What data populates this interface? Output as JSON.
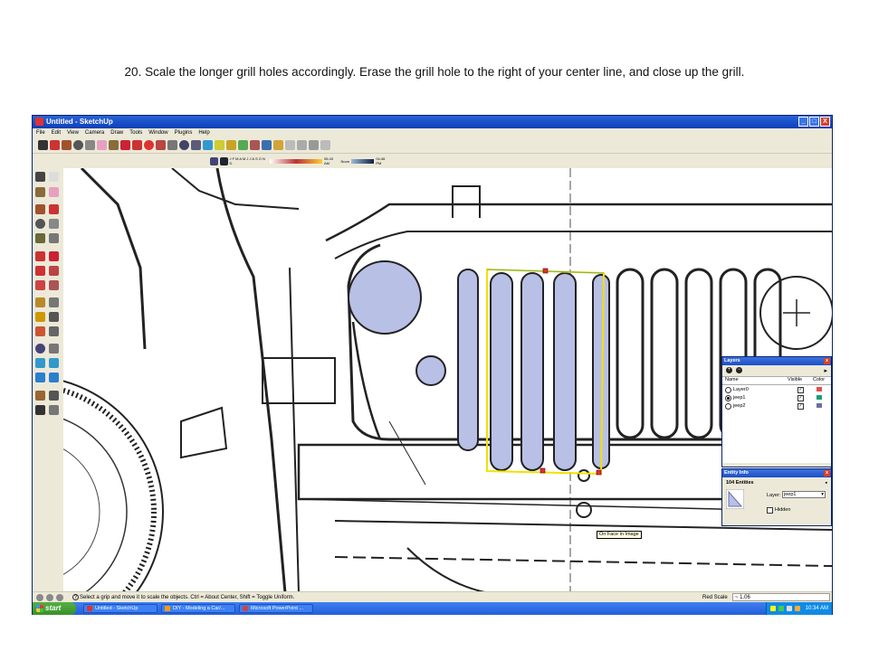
{
  "caption": "20. Scale the longer grill holes accordingly. Erase the grill hole to the right of your center line, and close up the grill.",
  "window": {
    "title": "Untitled - SketchUp",
    "controls": [
      "_",
      "□",
      "X"
    ]
  },
  "menu": [
    "File",
    "Edit",
    "View",
    "Camera",
    "Draw",
    "Tools",
    "Window",
    "Plugins",
    "Help"
  ],
  "toolbar_icons": [
    "select-icon",
    "pencil-icon",
    "rectangle-icon",
    "circle-icon",
    "arc-icon",
    "eraser-icon",
    "paint-bucket-icon",
    "push-pull-icon",
    "move-icon",
    "rotate-icon",
    "follow-me-icon",
    "tape-measure-icon",
    "orbit-icon",
    "pan-icon",
    "zoom-icon",
    "zoom-extents-icon",
    "zoom-window-icon",
    "previous-icon",
    "next-icon",
    "iso-view-icon",
    "top-view-icon",
    "front-view-icon",
    "xray-icon",
    "wireframe-icon",
    "shaded-icon"
  ],
  "shadow_bar": {
    "months": "J F M A M J J A S O N D",
    "time_start": "06:43 AM",
    "noon": "Noon",
    "time_end": "04:46 PM"
  },
  "colors": {
    "face_fill": "#b8c0e6",
    "selection": "#f2e200",
    "accent_red": "#e23030",
    "layer0": "#e05050",
    "jeep1": "#1f9a7a",
    "jeep2": "#6a70a0"
  },
  "layers_panel": {
    "title": "Layers",
    "headers": [
      "Name",
      "Visible",
      "Color"
    ],
    "rows": [
      {
        "name": "Layer0",
        "active": false,
        "visible": true,
        "color": "#e05050"
      },
      {
        "name": "jeep1",
        "active": true,
        "visible": true,
        "color": "#1f9a7a"
      },
      {
        "name": "jeep2",
        "active": false,
        "visible": true,
        "color": "#6a70a0"
      }
    ]
  },
  "entity_panel": {
    "title": "Entity Info",
    "count_label": "104 Entities",
    "layer_label": "Layer:",
    "layer_value": "jeep1",
    "hidden_label": "Hidden"
  },
  "tooltip": "On Face in Image",
  "status": {
    "hint": "Select a grip and move it to scale the objects. Ctrl = About Center, Shift = Toggle Uniform.",
    "value_label": "Red Scale",
    "value": "~ 1.06"
  },
  "taskbar": {
    "start": "start",
    "tasks": [
      "Untitled - SketchUp",
      "DIY - Modeling a Car/...",
      "Microsoft PowerPoint ..."
    ],
    "clock": "10:34 AM"
  }
}
